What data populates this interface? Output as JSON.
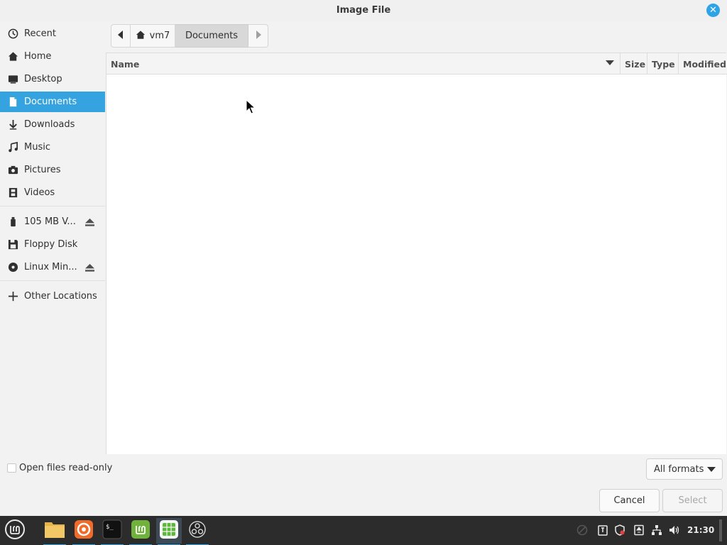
{
  "window": {
    "title": "Image File"
  },
  "sidebar": {
    "items": [
      {
        "label": "Recent",
        "icon": "clock-icon"
      },
      {
        "label": "Home",
        "icon": "home-icon"
      },
      {
        "label": "Desktop",
        "icon": "desktop-icon"
      },
      {
        "label": "Documents",
        "icon": "document-icon",
        "active": true
      },
      {
        "label": "Downloads",
        "icon": "download-icon"
      },
      {
        "label": "Music",
        "icon": "music-icon"
      },
      {
        "label": "Pictures",
        "icon": "camera-icon"
      },
      {
        "label": "Videos",
        "icon": "film-icon"
      }
    ],
    "devices": [
      {
        "label": "105 MB V...",
        "icon": "usb-drive-icon",
        "ejectable": true
      },
      {
        "label": "Floppy Disk",
        "icon": "floppy-icon",
        "ejectable": false
      },
      {
        "label": "Linux Min...",
        "icon": "optical-disc-icon",
        "ejectable": true
      }
    ],
    "other": {
      "label": "Other Locations",
      "icon": "plus-icon"
    }
  },
  "pathbar": {
    "home_label": "vm7",
    "current_label": "Documents"
  },
  "filelist": {
    "columns": [
      "Name",
      "Size",
      "Type",
      "Modified"
    ],
    "sort_column": "Name",
    "rows": []
  },
  "footer": {
    "readonly_label": "Open files read-only",
    "readonly_checked": false,
    "format_selected": "All formats",
    "cancel_label": "Cancel",
    "select_label": "Select"
  },
  "taskbar": {
    "apps": [
      "mint-menu-icon",
      "files-icon",
      "firefox-icon",
      "terminal-icon",
      "mint-update-icon",
      "calc-icon",
      "obs-icon"
    ],
    "clock": "21:30"
  },
  "colors": {
    "accent": "#35a3e0",
    "taskbar": "#2c2c2c"
  }
}
